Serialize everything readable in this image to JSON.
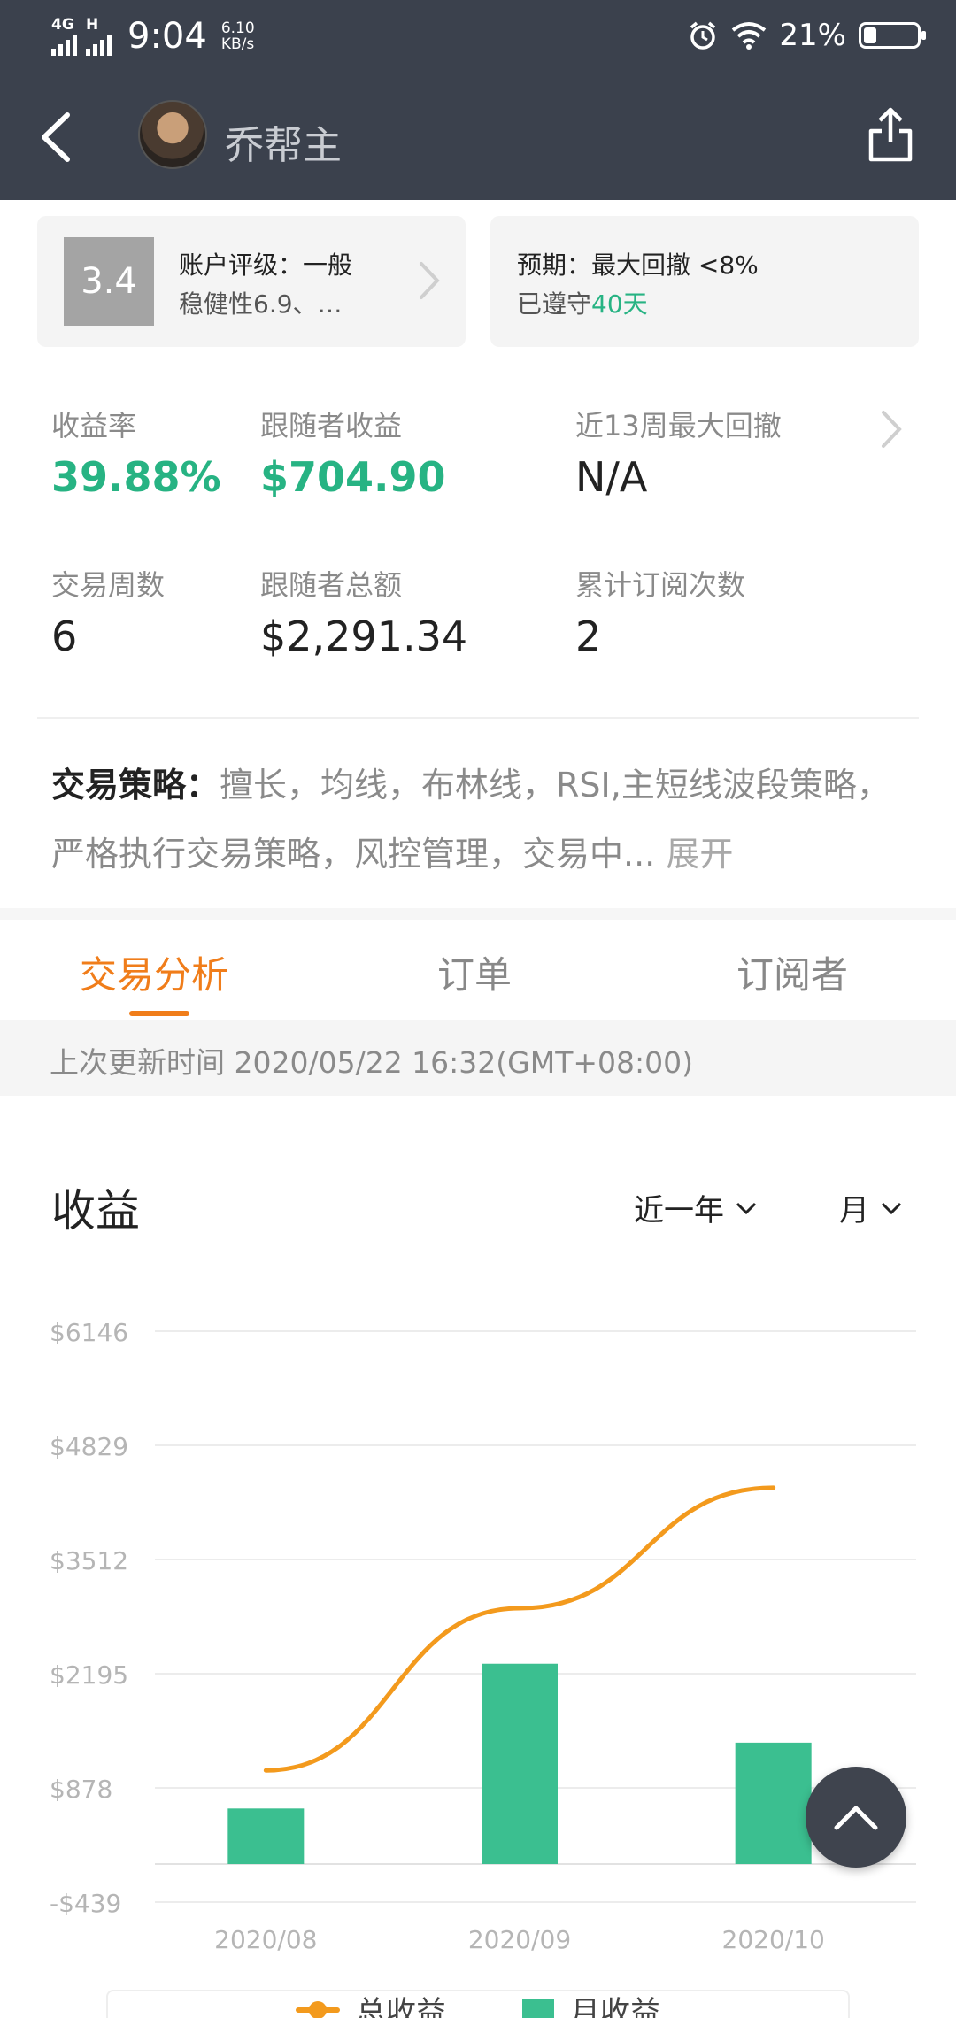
{
  "status_bar": {
    "network1": "4G",
    "network2": "H",
    "time": "9:04",
    "speed_value": "6.10",
    "speed_unit": "KB/s",
    "battery": "21%"
  },
  "header": {
    "username": "乔帮主",
    "icons": [
      "back-arrow-icon",
      "share-icon"
    ]
  },
  "card_rating": {
    "score": "3.4",
    "title": "账户评级：一般",
    "subtitle": "稳健性6.9、…"
  },
  "card_expectation": {
    "title": "预期：最大回撤 <8%",
    "prefix": "已遵守",
    "days": "40天"
  },
  "stats": {
    "return_label": "收益率",
    "return_value": "39.88%",
    "follower_profit_label": "跟随者收益",
    "follower_profit_value": "$704.90",
    "drawdown_label": "近13周最大回撤",
    "drawdown_value": "N/A",
    "weeks_label": "交易周数",
    "weeks_value": "6",
    "follower_total_label": "跟随者总额",
    "follower_total_value": "$2,291.34",
    "subs_label": "累计订阅次数",
    "subs_value": "2"
  },
  "strategy": {
    "label": "交易策略：",
    "text": "擅长，均线，布林线，RSI,主短线波段策略，严格执行交易策略，风控管理，交易中...",
    "expand": "展开"
  },
  "tabs": [
    "交易分析",
    "订单",
    "订阅者"
  ],
  "update": {
    "text": "上次更新时间 2020/05/22 16:32(GMT+08:00)"
  },
  "income": {
    "title": "收益",
    "range": "近一年",
    "period": "月"
  },
  "chart_data": {
    "type": "bar",
    "categories": [
      "2020/08",
      "2020/09",
      "2020/10"
    ],
    "y_ticks": [
      "$6146",
      "$4829",
      "$3512",
      "$2195",
      "$878",
      "-$439"
    ],
    "ylim": [
      -439,
      6146
    ],
    "series": [
      {
        "name": "总收益",
        "kind": "line",
        "values": [
          1080,
          2950,
          4340
        ],
        "color": "#f39a1d"
      },
      {
        "name": "月收益",
        "kind": "bar",
        "values": [
          640,
          2310,
          1400
        ],
        "color": "#3bbf90"
      }
    ],
    "legend_position": "bottom"
  }
}
